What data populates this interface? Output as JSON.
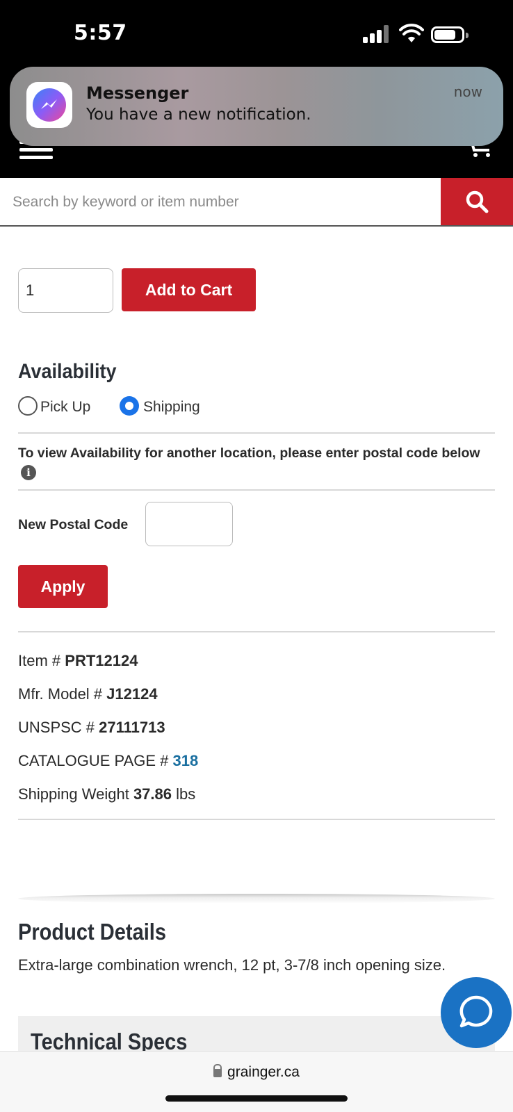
{
  "status_bar": {
    "time": "5:57"
  },
  "notification": {
    "app": "Messenger",
    "message": "You have a new notification.",
    "time": "now"
  },
  "search": {
    "placeholder": "Search by keyword or item number"
  },
  "purchase": {
    "quantity": "1",
    "add_to_cart_label": "Add to Cart"
  },
  "availability": {
    "heading": "Availability",
    "options": [
      {
        "label": "Pick Up",
        "selected": false
      },
      {
        "label": "Shipping",
        "selected": true
      }
    ],
    "postal_note": "To view Availability for another location, please enter postal code below",
    "postal_label": "New Postal Code",
    "postal_value": "",
    "apply_label": "Apply"
  },
  "item_info": {
    "item_label": "Item #",
    "item_value": "PRT12124",
    "model_label": "Mfr. Model #",
    "model_value": "J12124",
    "unspsc_label": "UNSPSC #",
    "unspsc_value": "27111713",
    "catalogue_label": "CATALOGUE PAGE #",
    "catalogue_value": "318",
    "weight_label": "Shipping Weight",
    "weight_value": "37.86",
    "weight_unit": "lbs"
  },
  "product_details": {
    "heading": "Product Details",
    "description": "Extra-large combination wrench, 12 pt, 3-7/8 inch opening size."
  },
  "technical_specs": {
    "heading": "Technical Specs"
  },
  "browser": {
    "url": "grainger.ca"
  },
  "colors": {
    "brand_red": "#c8202a",
    "link_blue": "#1a6fa0",
    "radio_blue": "#1a73e8",
    "chat_blue": "#1a72c4"
  },
  "icons": [
    "menu-icon",
    "cart-icon",
    "search-icon",
    "info-icon",
    "chat-icon",
    "lock-icon",
    "messenger-icon"
  ]
}
